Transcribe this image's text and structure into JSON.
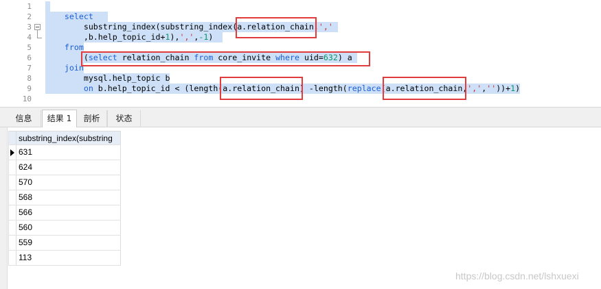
{
  "editor": {
    "syntax_colors": {
      "keyword": "#1b5fd6",
      "string": "#c4302b",
      "number": "#0a9467"
    },
    "annotation_color": "#e23b3b",
    "lines": [
      {
        "number": "1",
        "selected": true,
        "tokens": [
          {
            "text": " "
          }
        ]
      },
      {
        "number": "2",
        "selected": true,
        "tokens": [
          {
            "text": "    "
          },
          {
            "text": "select",
            "type": "keyword"
          },
          {
            "text": "   "
          }
        ]
      },
      {
        "number": "3",
        "selected": true,
        "tokens": [
          {
            "text": "        substring_index(substring_index(a.relation_chain,"
          },
          {
            "text": "','",
            "type": "string"
          },
          {
            "text": " "
          }
        ]
      },
      {
        "number": "4",
        "selected": true,
        "tokens": [
          {
            "text": "        ,b.help_topic_id+"
          },
          {
            "text": "1",
            "type": "number"
          },
          {
            "text": "),"
          },
          {
            "text": "','",
            "type": "string"
          },
          {
            "text": ","
          },
          {
            "text": "-1",
            "type": "number"
          },
          {
            "text": ")  "
          }
        ]
      },
      {
        "number": "5",
        "selected": true,
        "tokens": [
          {
            "text": "    "
          },
          {
            "text": "from",
            "type": "keyword"
          }
        ]
      },
      {
        "number": "6",
        "selected": true,
        "tokens": [
          {
            "text": "        ("
          },
          {
            "text": "select",
            "type": "keyword"
          },
          {
            "text": " relation_chain "
          },
          {
            "text": "from",
            "type": "keyword"
          },
          {
            "text": " core_invite "
          },
          {
            "text": "where",
            "type": "keyword"
          },
          {
            "text": " uid="
          },
          {
            "text": "632",
            "type": "number"
          },
          {
            "text": ") a "
          }
        ]
      },
      {
        "number": "7",
        "selected": true,
        "tokens": [
          {
            "text": "    "
          },
          {
            "text": "join",
            "type": "keyword"
          }
        ]
      },
      {
        "number": "8",
        "selected": true,
        "tokens": [
          {
            "text": "        mysql.help_topic b"
          }
        ]
      },
      {
        "number": "9",
        "selected": true,
        "tokens": [
          {
            "text": "        "
          },
          {
            "text": "on",
            "type": "keyword"
          },
          {
            "text": " b.help_topic_id < (length(a.relation_chain) -length("
          },
          {
            "text": "replace",
            "type": "keyword"
          },
          {
            "text": "(a.relation_chain,"
          },
          {
            "text": "','",
            "type": "string"
          },
          {
            "text": ","
          },
          {
            "text": "''",
            "type": "string"
          },
          {
            "text": "))+"
          },
          {
            "text": "1",
            "type": "number"
          },
          {
            "text": ")"
          }
        ]
      },
      {
        "number": "10",
        "selected": false,
        "tokens": []
      }
    ]
  },
  "results": {
    "tabs": [
      {
        "label": "信息",
        "active": false
      },
      {
        "label": "结果 1",
        "active": true
      },
      {
        "label": "剖析",
        "active": false
      },
      {
        "label": "状态",
        "active": false
      }
    ],
    "column_header": "substring_index(substring",
    "rows": [
      "631",
      "624",
      "570",
      "568",
      "566",
      "560",
      "559",
      "113"
    ],
    "current_row_index": 0
  },
  "watermark": "https://blog.csdn.net/lshxuexi"
}
